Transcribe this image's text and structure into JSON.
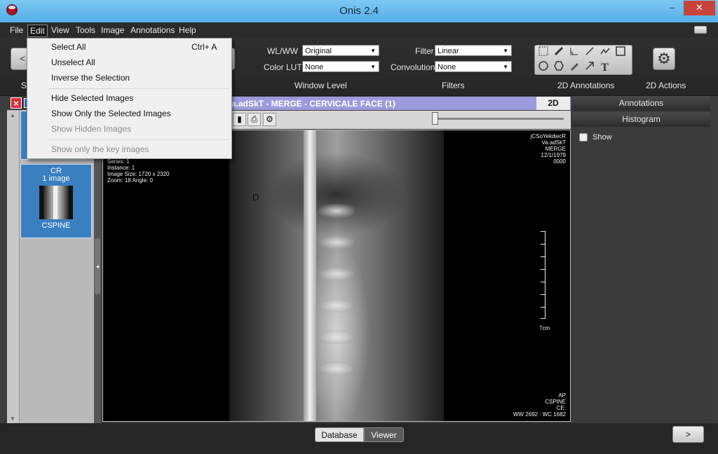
{
  "window": {
    "title": "Onis 2.4",
    "minimize": "–",
    "maximize": "□",
    "close": "✕"
  },
  "menubar": {
    "items": [
      "File",
      "Edit",
      "View",
      "Tools",
      "Image",
      "Annotations",
      "Help"
    ]
  },
  "toolbar": {
    "back_glyph": "<",
    "wlww_label": "WL/WW",
    "wlww_value": "Original",
    "color_lut_label": "Color LUT",
    "color_lut_value": "None",
    "filter_label": "Filter",
    "filter_value": "Linear",
    "convolution_label": "Convolution",
    "convolution_value": "None",
    "sections": {
      "left_partial": "St",
      "window_level": "Window Level",
      "filters": "Filters",
      "annotations_2d": "2D Annotations",
      "actions_2d": "2D Actions"
    },
    "tools": [
      "select-rect",
      "ruler",
      "angle",
      "line",
      "polyline",
      "rectangle",
      "ellipse",
      "polygon",
      "pencil",
      "arrow",
      "text"
    ],
    "tool_glyphs": {
      "text": "T"
    }
  },
  "sidebar": {
    "thumb_2": {
      "modality": "CR",
      "count": "1 image",
      "label": "CSPINE"
    }
  },
  "viewer": {
    "title": "a.adSkT - MERGE - CERVICALE FACE (1)",
    "mode_button": "2D",
    "overlay_top_left": [
      "Series: 1",
      "Instance: 1",
      "Image Size: 1720 x 2320",
      "Zoom: 18 Angle: 0"
    ],
    "overlay_top_right": [
      "jCSoYekdwcR",
      "Va.adSkT",
      "MERGE",
      "12/1/1979",
      "0000"
    ],
    "overlay_bottom_right": [
      "AP",
      "CSPINE",
      "CE:",
      "WW 2692 : WC 1682"
    ],
    "marker": "D",
    "ruler_label": "7cm"
  },
  "right_panel": {
    "annotations_header": "Annotations",
    "histogram_header": "Histogram",
    "show_label": "Show"
  },
  "bottom": {
    "database_tab": "Database",
    "viewer_tab": "Viewer",
    "next_button": ">"
  },
  "edit_menu": {
    "select_all": "Select All",
    "select_all_shortcut": "Ctrl+ A",
    "unselect_all": "Unselect All",
    "inverse_selection": "Inverse the Selection",
    "hide_selected": "Hide Selected Images",
    "show_only_selected": "Show Only the Selected Images",
    "show_hidden": "Show Hidden Images",
    "show_only_key": "Show only the key images"
  },
  "colors": {
    "titlebar": "#5fb4ec",
    "close": "#c7443c",
    "thumb_bg": "#3a7fc0",
    "viewer_header": "#9b9bdc"
  }
}
